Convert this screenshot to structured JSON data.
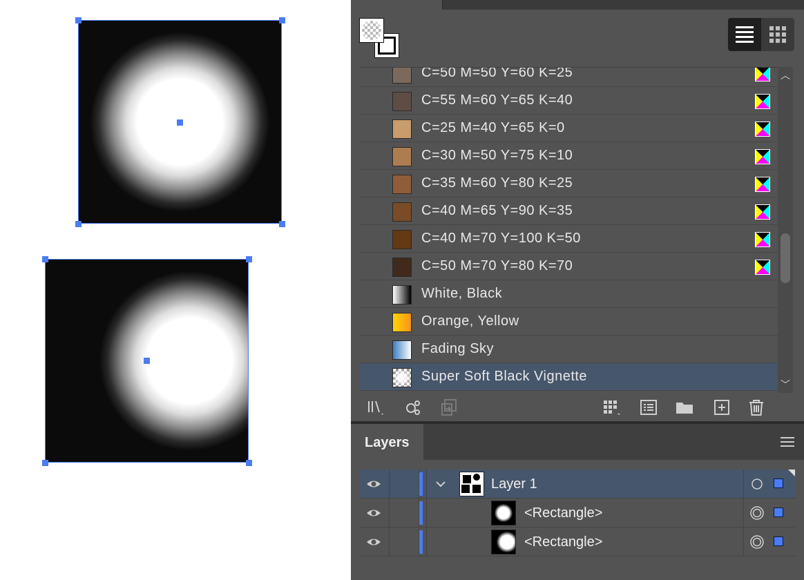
{
  "colors": {
    "selection": "#4a7cf3",
    "panel_bg": "#535353",
    "selected_row": "#46566b"
  },
  "canvas": {
    "objects": [
      {
        "name": "vignette-rectangle-1",
        "gradient": "Super Soft Black Vignette"
      },
      {
        "name": "vignette-rectangle-2",
        "gradient": "Super Soft Black Vignette"
      }
    ]
  },
  "swatches": {
    "view_list_icon": "list-view-icon",
    "view_grid_icon": "grid-view-icon",
    "items": [
      {
        "label": "C=50 M=50 Y=60 K=25",
        "color": "#7b6a5c",
        "type": "process"
      },
      {
        "label": "C=55 M=60 Y=65 K=40",
        "color": "#5e4d45",
        "type": "process"
      },
      {
        "label": "C=25 M=40 Y=65 K=0",
        "color": "#c89c6b",
        "type": "process"
      },
      {
        "label": "C=30 M=50 Y=75 K=10",
        "color": "#ad7d50",
        "type": "process"
      },
      {
        "label": "C=35 M=60 Y=80 K=25",
        "color": "#8f5d38",
        "type": "process"
      },
      {
        "label": "C=40 M=65 Y=90 K=35",
        "color": "#7a4b25",
        "type": "process"
      },
      {
        "label": "C=40 M=70 Y=100 K=50",
        "color": "#633a12",
        "type": "process"
      },
      {
        "label": "C=50 M=70 Y=80 K=70",
        "color": "#3f2a1c",
        "type": "process"
      },
      {
        "label": "White, Black",
        "color": "linear-gradient(90deg,#fff,#000)",
        "type": "gradient"
      },
      {
        "label": "Orange, Yellow",
        "color": "linear-gradient(90deg,#ffd500,#f7931e)",
        "type": "gradient"
      },
      {
        "label": "Fading Sky",
        "color": "linear-gradient(90deg,#3c7fc1,#ffffff)",
        "type": "gradient"
      },
      {
        "label": "Super Soft Black Vignette",
        "color": "radial",
        "type": "gradient",
        "selected": true
      }
    ],
    "footer_buttons": [
      {
        "name": "swatch-libraries-menu-button",
        "icon": "library-icon"
      },
      {
        "name": "show-swatch-kinds-button",
        "icon": "swatch-kinds-icon"
      },
      {
        "name": "swatch-options-button",
        "icon": "swatch-options-icon"
      },
      {
        "name": "new-color-group-button",
        "icon": "color-group-icon"
      },
      {
        "name": "swatch-options-button-2",
        "icon": "swatch-list-icon"
      },
      {
        "name": "new-color-group-folder-button",
        "icon": "folder-icon"
      },
      {
        "name": "new-swatch-button",
        "icon": "new-swatch-icon"
      },
      {
        "name": "delete-swatch-button",
        "icon": "trash-icon"
      }
    ]
  },
  "layers": {
    "title": "Layers",
    "rows": [
      {
        "label": "Layer 1",
        "level": 0,
        "expanded": true,
        "selected": true
      },
      {
        "label": "<Rectangle>",
        "level": 1,
        "selected": false
      },
      {
        "label": "<Rectangle>",
        "level": 1,
        "selected": false
      }
    ]
  }
}
